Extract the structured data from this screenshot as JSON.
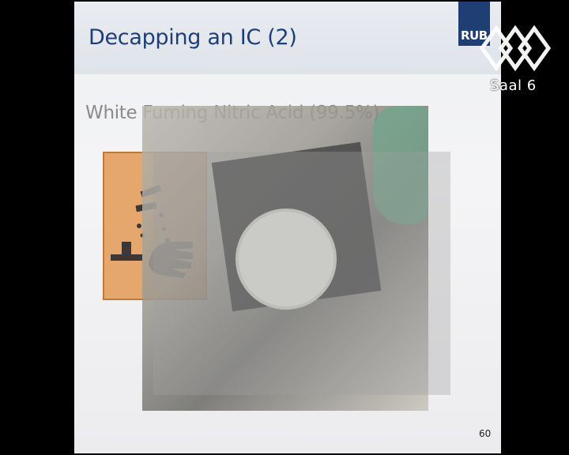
{
  "slide": {
    "title": "Decapping an IC (2)",
    "logo_text": "RUB",
    "subtitle": "White Fuming Nitric Acid (99.5%)",
    "page_number": "60"
  },
  "stream_overlay": {
    "room_label": "Saal 6",
    "logo_icon": "conference-logo-icon"
  },
  "colors": {
    "title": "#1d3e78",
    "hazard_bg": "#e6a76c",
    "logo_bg": "#1f3e73"
  }
}
